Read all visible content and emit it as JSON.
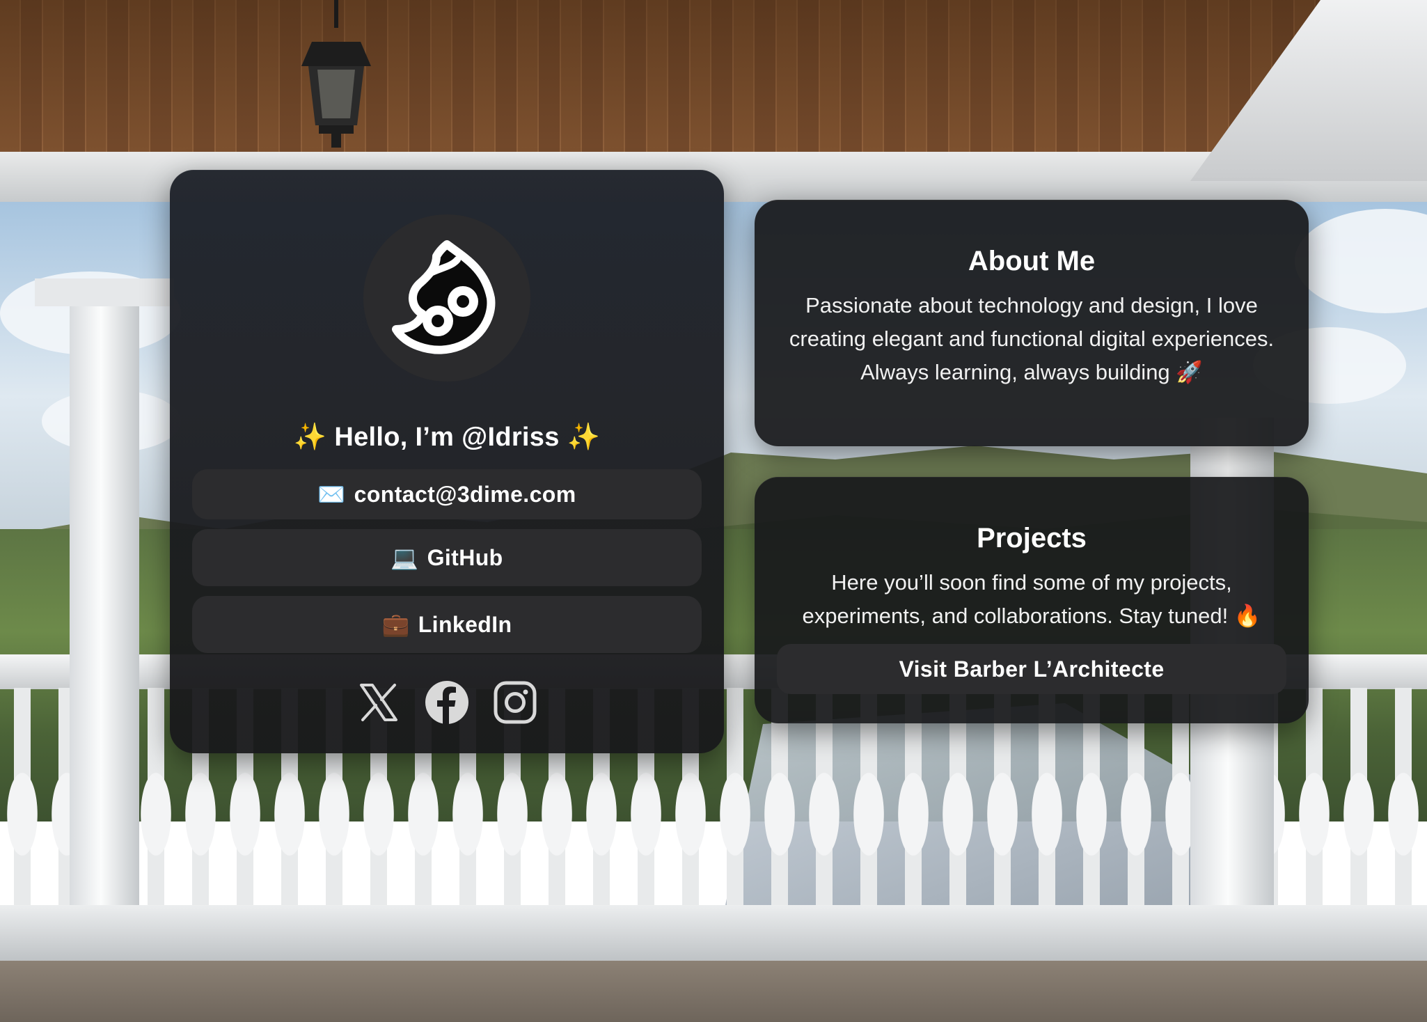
{
  "profile": {
    "avatar_icon": "owl-logo-icon",
    "greeting_prefix": "✨",
    "greeting": "Hello, I’m @Idriss",
    "greeting_suffix": "✨",
    "links": [
      {
        "emoji": "✉️",
        "icon": "envelope-icon",
        "label": "contact@3dime.com"
      },
      {
        "emoji": "💻",
        "icon": "laptop-icon",
        "label": "GitHub"
      },
      {
        "emoji": "💼",
        "icon": "briefcase-icon",
        "label": "LinkedIn"
      }
    ],
    "socials": [
      {
        "icon": "x-twitter-icon"
      },
      {
        "icon": "facebook-icon"
      },
      {
        "icon": "instagram-icon"
      }
    ]
  },
  "about": {
    "title": "About Me",
    "text": "Passionate about technology and design, I love creating elegant and functional digital experiences. Always learning, always building 🚀"
  },
  "projects": {
    "title": "Projects",
    "text": "Here you’ll soon find some of my projects, experiments, and collaborations. Stay tuned! 🔥",
    "button_label": "Visit Barber L’Architecte"
  },
  "colors": {
    "card_bg": "#18191b",
    "button_bg": "#2c2c2e",
    "text": "#ffffff"
  }
}
